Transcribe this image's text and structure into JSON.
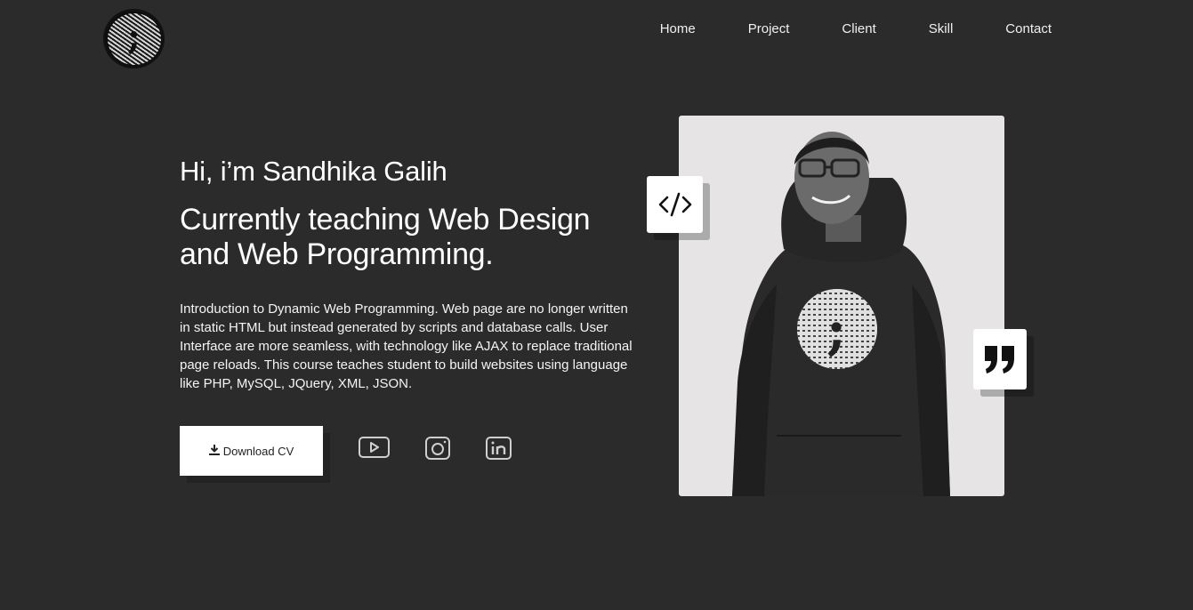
{
  "nav": {
    "items": [
      "Home",
      "Project",
      "Client",
      "Skill",
      "Contact"
    ]
  },
  "hero": {
    "greeting": "Hi, i’m Sandhika Galih",
    "headline": "Currently teaching Web Design and Web Programming.",
    "intro": "Introduction to Dynamic Web Programming. Web page are no longer written in static HTML but instead generated by scripts and database calls. User Interface are more seamless, with technology like AJAX to replace traditional page reloads. This course teaches student to build websites using language like PHP, MySQL, JQuery, XML, JSON."
  },
  "buttons": {
    "download_cv": "Download CV"
  },
  "social": [
    "youtube-icon",
    "instagram-icon",
    "linkedin-icon"
  ],
  "badges": [
    "code-icon",
    "quote-icon"
  ],
  "colors": {
    "background": "#2b2b2b",
    "photo_background": "#e6e4e5",
    "card": "#ffffff"
  }
}
